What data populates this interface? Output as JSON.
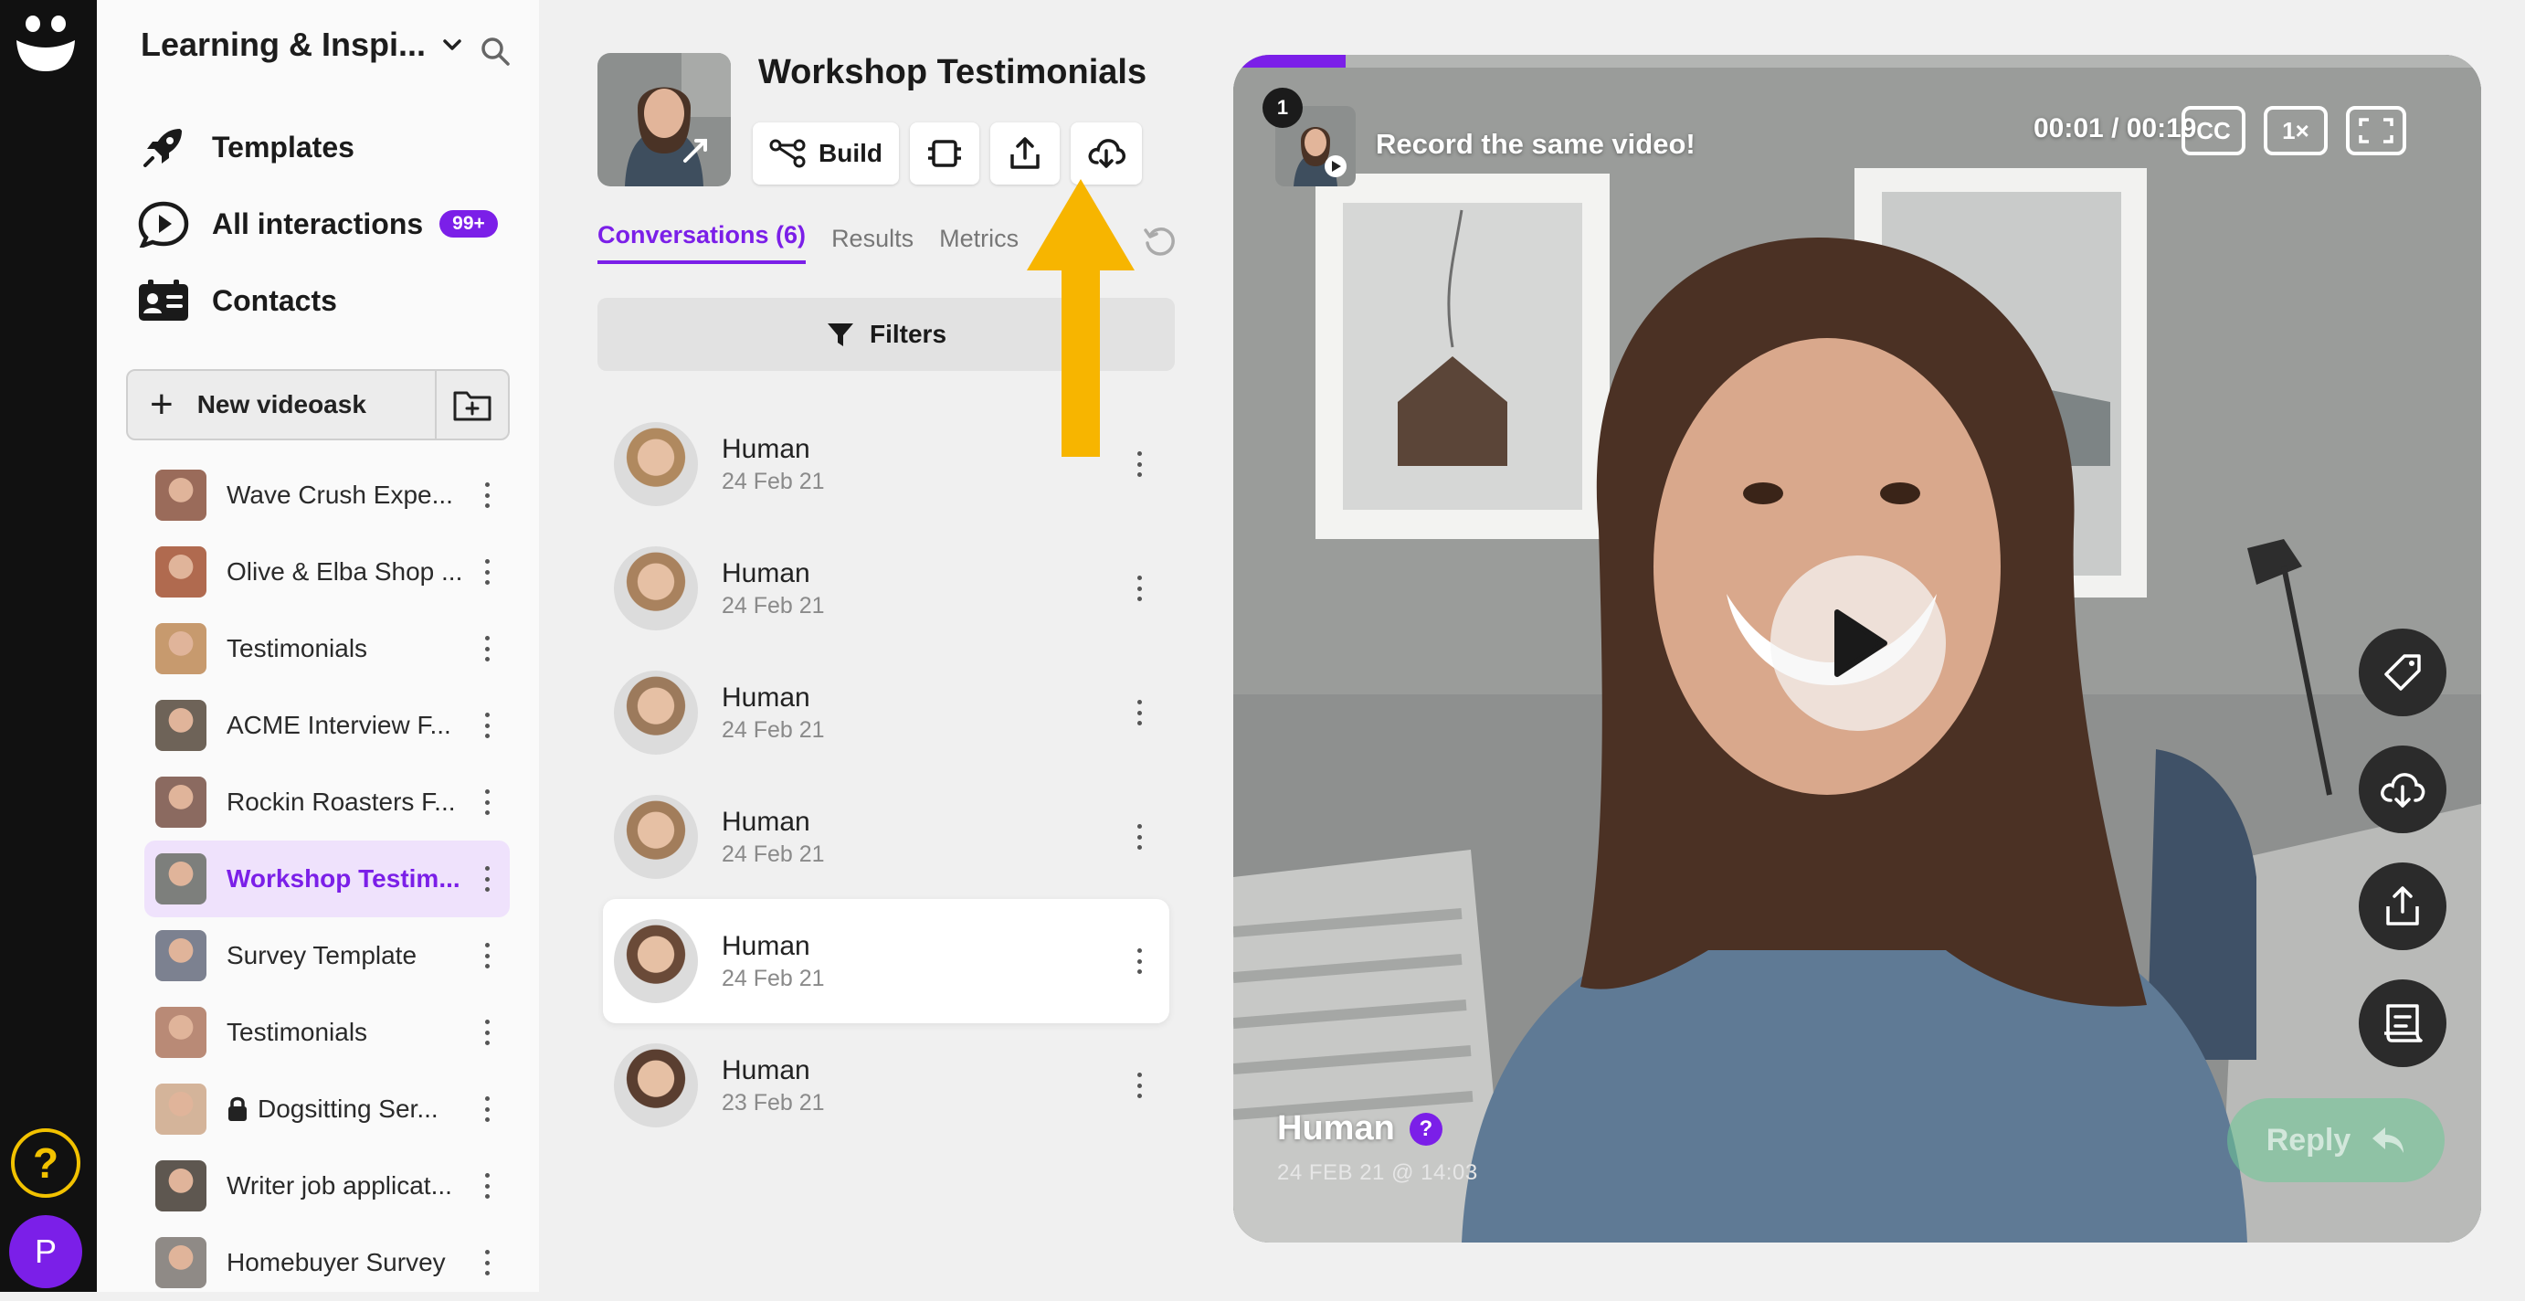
{
  "workspace": {
    "name": "Learning & Inspi..."
  },
  "nav": [
    {
      "label": "Templates",
      "icon": "rocket-icon"
    },
    {
      "label": "All interactions",
      "icon": "play-bubble-icon",
      "badge": "99+"
    },
    {
      "label": "Contacts",
      "icon": "contacts-card-icon"
    }
  ],
  "new_videoask": {
    "label": "New videoask",
    "plus": "+"
  },
  "folders": [
    {
      "label": "Wave Crush Expe...",
      "locked": false,
      "active": false,
      "thumb": "#9a6b5a"
    },
    {
      "label": "Olive & Elba Shop ...",
      "locked": false,
      "active": false,
      "thumb": "#b06a4f"
    },
    {
      "label": "Testimonials",
      "locked": false,
      "active": false,
      "thumb": "#c79a6e"
    },
    {
      "label": "ACME Interview F...",
      "locked": false,
      "active": false,
      "thumb": "#6e6358"
    },
    {
      "label": "Rockin Roasters F...",
      "locked": false,
      "active": false,
      "thumb": "#8b6a60"
    },
    {
      "label": "Workshop Testim...",
      "locked": false,
      "active": true,
      "thumb": "#7d7f7c"
    },
    {
      "label": "Survey Template",
      "locked": false,
      "active": false,
      "thumb": "#7c8190"
    },
    {
      "label": "Testimonials",
      "locked": false,
      "active": false,
      "thumb": "#b98a76"
    },
    {
      "label": "Dogsitting Ser...",
      "locked": true,
      "active": false,
      "thumb": "#d4b49a"
    },
    {
      "label": "Writer job applicat...",
      "locked": false,
      "active": false,
      "thumb": "#5e5750"
    },
    {
      "label": "Homebuyer Survey",
      "locked": false,
      "active": false,
      "thumb": "#8f8a86"
    }
  ],
  "videoask": {
    "title": "Workshop Testimonials",
    "build_label": "Build"
  },
  "tabs": [
    {
      "label": "Conversations (6)",
      "active": true
    },
    {
      "label": "Results",
      "active": false
    },
    {
      "label": "Metrics",
      "active": false
    }
  ],
  "filters_label": "Filters",
  "conversations": [
    {
      "name": "Human",
      "date": "24 Feb 21",
      "selected": false,
      "tone": "#b0895f"
    },
    {
      "name": "Human",
      "date": "24 Feb 21",
      "selected": false,
      "tone": "#a9825e"
    },
    {
      "name": "Human",
      "date": "24 Feb 21",
      "selected": false,
      "tone": "#9c7a5c"
    },
    {
      "name": "Human",
      "date": "24 Feb 21",
      "selected": false,
      "tone": "#a27d5b"
    },
    {
      "name": "Human",
      "date": "24 Feb 21",
      "selected": true,
      "tone": "#6a4a38"
    },
    {
      "name": "Human",
      "date": "23 Feb 21",
      "selected": false,
      "tone": "#5a3e30"
    }
  ],
  "player": {
    "step": "1",
    "question_title": "Record the same video!",
    "time": "00:01 / 00:19",
    "cc_label": "CC",
    "speed_label": "1×",
    "progress": 0.09,
    "respondent_name": "Human",
    "respondent_help": "?",
    "respondent_date": "24 FEB 21 @ 14:03",
    "reply_label": "Reply"
  },
  "user_initial": "P",
  "help_symbol": "?",
  "colors": {
    "accent": "#7b1fe8",
    "arrow": "#f7b500",
    "rail": "#111111"
  }
}
